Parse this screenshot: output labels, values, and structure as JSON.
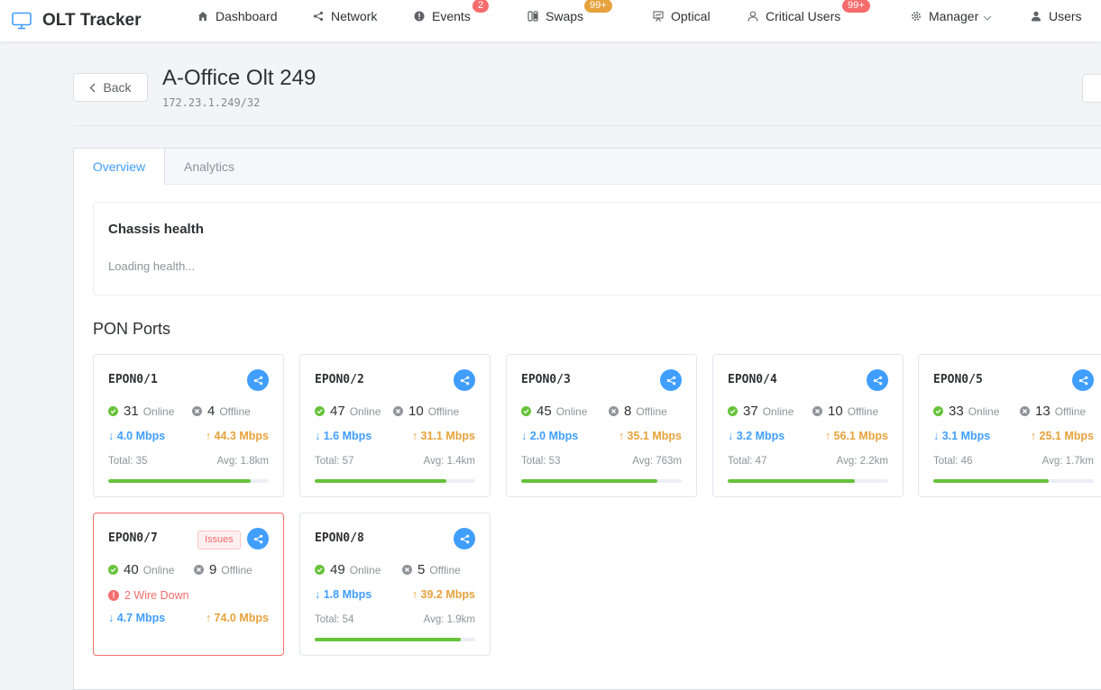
{
  "app": {
    "title": "OLT Tracker"
  },
  "nav": [
    {
      "label": "Dashboard",
      "icon": "home-icon"
    },
    {
      "label": "Network",
      "icon": "share-icon"
    },
    {
      "label": "Events",
      "icon": "alert-icon",
      "badge": "2"
    },
    {
      "label": "Swaps",
      "icon": "swap-icon",
      "badge": "99+"
    },
    {
      "label": "Optical",
      "icon": "presentation-icon"
    },
    {
      "label": "Critical Users",
      "icon": "user-icon",
      "badge": "99+"
    },
    {
      "label": "Manager",
      "icon": "gear-icon"
    },
    {
      "label": "Users",
      "icon": "person-icon"
    }
  ],
  "header": {
    "back_label": "Back",
    "title": "A-Office Olt 249",
    "subtitle": "172.23.1.249/32"
  },
  "tabs": [
    {
      "label": "Overview"
    },
    {
      "label": "Analytics"
    }
  ],
  "chassis": {
    "title": "Chassis health",
    "status": "Loading health..."
  },
  "pon": {
    "title": "PON Ports",
    "online_label": "Online",
    "offline_label": "Offline",
    "ports": [
      {
        "name": "EPON0/1",
        "online": "31",
        "offline": "4",
        "down": "↓ 4.0 Mbps",
        "up": "↑ 44.3 Mbps",
        "total": "Total: 35",
        "avg": "Avg: 1.8km",
        "online_fraction": 0.89
      },
      {
        "name": "EPON0/2",
        "online": "47",
        "offline": "10",
        "down": "↓ 1.6 Mbps",
        "up": "↑ 31.1 Mbps",
        "total": "Total: 57",
        "avg": "Avg: 1.4km",
        "online_fraction": 0.82
      },
      {
        "name": "EPON0/3",
        "online": "45",
        "offline": "8",
        "down": "↓ 2.0 Mbps",
        "up": "↑ 35.1 Mbps",
        "total": "Total: 53",
        "avg": "Avg: 763m",
        "online_fraction": 0.85
      },
      {
        "name": "EPON0/4",
        "online": "37",
        "offline": "10",
        "down": "↓ 3.2 Mbps",
        "up": "↑ 56.1 Mbps",
        "total": "Total: 47",
        "avg": "Avg: 2.2km",
        "online_fraction": 0.79
      },
      {
        "name": "EPON0/5",
        "online": "33",
        "offline": "13",
        "down": "↓ 3.1 Mbps",
        "up": "↑ 25.1 Mbps",
        "total": "Total: 46",
        "avg": "Avg: 1.7km",
        "online_fraction": 0.72
      },
      {
        "name": "EPON0/7",
        "online": "40",
        "offline": "9",
        "tag": "Issues",
        "alert": "2 Wire Down",
        "down": "↓ 4.7 Mbps",
        "up": "↑ 74.0 Mbps"
      },
      {
        "name": "EPON0/8",
        "online": "49",
        "offline": "5",
        "down": "↓ 1.8 Mbps",
        "up": "↑ 39.2 Mbps",
        "total": "Total: 54",
        "avg": "Avg: 1.9km",
        "online_fraction": 0.91
      }
    ]
  },
  "colors": {
    "accent": "#409eff",
    "online": "#67c23a",
    "warning": "#e6a23c",
    "danger": "#f56c6c"
  }
}
